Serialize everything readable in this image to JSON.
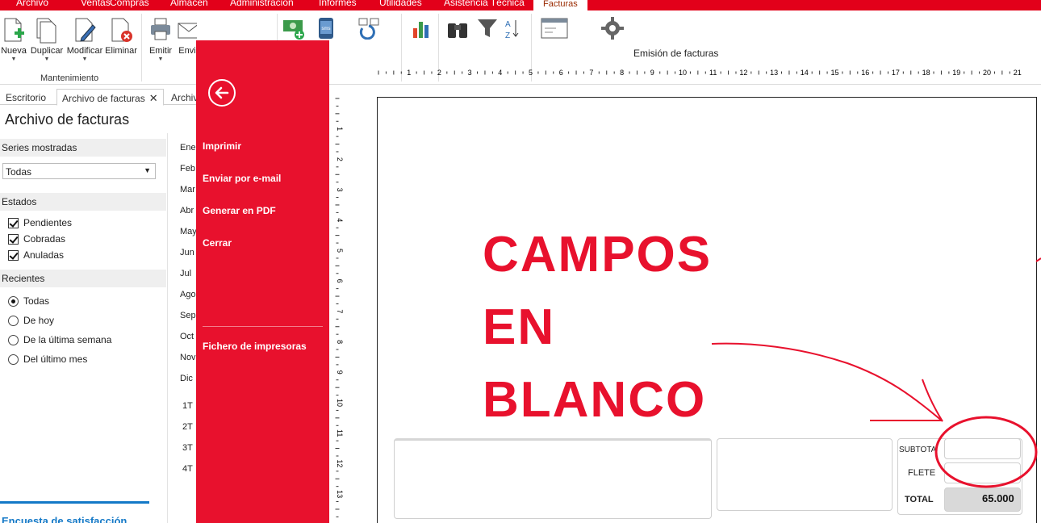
{
  "menu": {
    "tabs": [
      "Archivo",
      "Ventas",
      "Compras",
      "Almacén",
      "Administración",
      "Informes",
      "Utilidades",
      "Asistencia Técnica",
      "Facturas"
    ],
    "active": "Facturas"
  },
  "ribbon": {
    "nueva": "Nueva",
    "duplicar": "Duplicar",
    "modificar": "Modificar",
    "eliminar": "Eliminar",
    "emitir": "Emitir",
    "enviar": "Envi",
    "group_mantenimiento": "Mantenimiento",
    "sms_text": "sms"
  },
  "doctabs": {
    "escritorio": "Escritorio",
    "archivo_facturas": "Archivo de facturas",
    "archivo_cut": "Archiv",
    "close_glyph": "✕"
  },
  "left_panel": {
    "title": "Archivo de facturas",
    "series_label": "Series mostradas",
    "series_value": "Todas",
    "estados_label": "Estados",
    "estados": [
      "Pendientes",
      "Cobradas",
      "Anuladas"
    ],
    "recientes_label": "Recientes",
    "recientes": [
      "Todas",
      "De hoy",
      "De la última semana",
      "Del último mes"
    ],
    "months": [
      "Ene",
      "Feb",
      "Mar",
      "Abr",
      "May",
      "Jun",
      "Jul",
      "Ago",
      "Sep",
      "Oct",
      "Nov",
      "Dic"
    ],
    "quarters": [
      "1T",
      "2T",
      "3T",
      "4T"
    ],
    "survey": "Encuesta de satisfacción"
  },
  "red_menu": {
    "items": [
      "Imprimir",
      "Enviar por e-mail",
      "Generar en PDF",
      "Cerrar"
    ],
    "printers": "Fichero de impresoras"
  },
  "preview": {
    "title": "Emisión de facturas",
    "ruler_h": [
      "1",
      "2",
      "3",
      "4",
      "5",
      "6",
      "7",
      "8",
      "9",
      "10",
      "11",
      "12",
      "13",
      "14",
      "15",
      "16",
      "17",
      "18",
      "19",
      "20",
      "21"
    ],
    "ruler_v": [
      "1",
      "2",
      "3",
      "4",
      "5",
      "6",
      "7",
      "8",
      "9",
      "10",
      "11",
      "12",
      "13"
    ],
    "annotation": [
      "CAMPOS",
      "EN",
      "BLANCO"
    ],
    "subtotal_label": "SUBTOTA",
    "flete_label": "FLETE",
    "total_label": "TOTAL",
    "total_value": "65.000"
  },
  "colors": {
    "brand_red": "#e8112d",
    "menu_red": "#e2001a",
    "survey_blue": "#1479c7"
  }
}
